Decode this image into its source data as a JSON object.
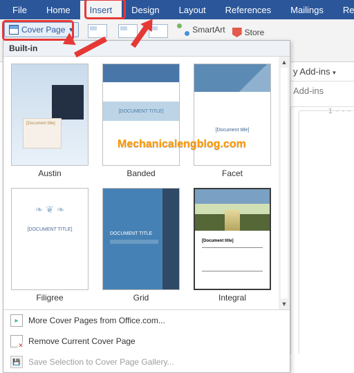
{
  "tabs": {
    "file": "File",
    "home": "Home",
    "insert": "Insert",
    "design": "Design",
    "layout": "Layout",
    "references": "References",
    "mailings": "Mailings",
    "review": "Revie"
  },
  "activeTab": "insert",
  "coverPage": {
    "label": "Cover Page"
  },
  "smartart": "SmartArt",
  "store": "Store",
  "rightSide": {
    "myAddins": "y Add-ins",
    "addins": "Add-ins"
  },
  "panel": {
    "header": "Built-in",
    "thumbs": {
      "austin": {
        "label": "Austin",
        "docTitle": "[Document title]"
      },
      "banded": {
        "label": "Banded",
        "docTitle": "[DOCUMENT TITLE]"
      },
      "facet": {
        "label": "Facet",
        "docTitle": "[Document title]"
      },
      "filigree": {
        "label": "Filigree",
        "docTitle": "[DOCUMENT TITLE]"
      },
      "grid": {
        "label": "Grid",
        "docTitle": "DOCUMENT TITLE"
      },
      "integral": {
        "label": "Integral",
        "docTitle": "[Document title]"
      }
    },
    "footer": {
      "more": "More Cover Pages from Office.com...",
      "remove": "Remove Current Cover Page",
      "save": "Save Selection to Cover Page Gallery..."
    }
  },
  "watermark": "Mechanicalengblog.com"
}
